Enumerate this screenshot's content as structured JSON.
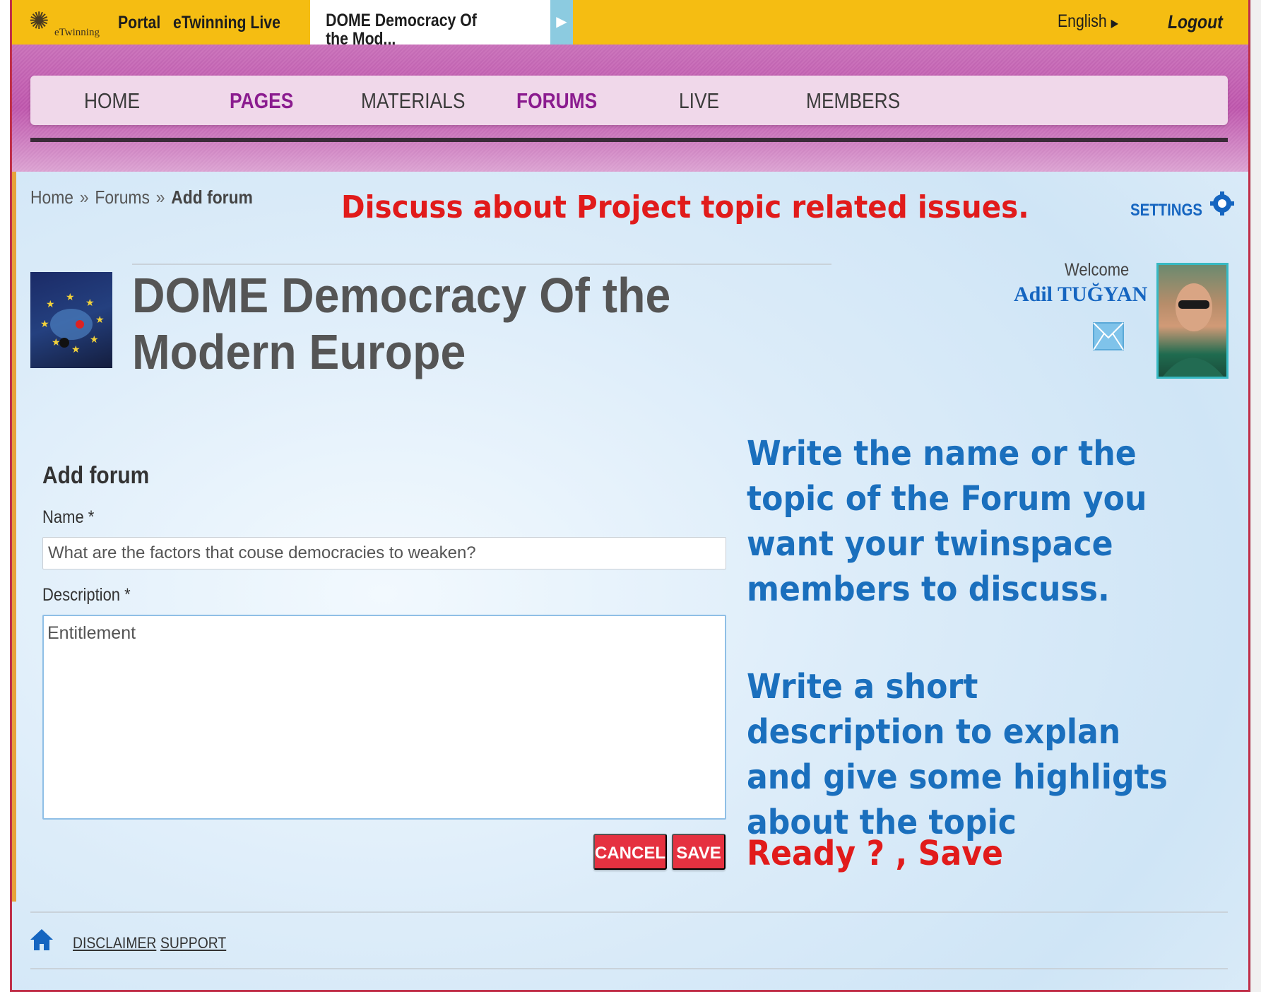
{
  "topbar": {
    "logo_text": "eTwinning",
    "links": [
      "Portal",
      "eTwinning Live"
    ],
    "current_tab": "DOME Democracy Of the Mod...",
    "language": "English",
    "logout": "Logout"
  },
  "nav": {
    "items": [
      {
        "label": "HOME",
        "active": false
      },
      {
        "label": "PAGES",
        "active": true
      },
      {
        "label": "MATERIALS",
        "active": false
      },
      {
        "label": "FORUMS",
        "active": true
      },
      {
        "label": "LIVE",
        "active": false
      },
      {
        "label": "MEMBERS",
        "active": false
      }
    ]
  },
  "breadcrumb": {
    "items": [
      "Home",
      "Forums",
      "Add forum"
    ],
    "separator": "»"
  },
  "annotations": {
    "top": "Discuss about Project topic related issues.",
    "name_help": "Write the name or the topic of the Forum you want your twinspace members to discuss.",
    "desc_help": "Write a short description to explan and give some highligts about the topic",
    "save_help": "Ready ? , Save"
  },
  "settings_label": "SETTINGS",
  "project": {
    "title": "DOME Democracy Of the Modern Europe"
  },
  "user": {
    "welcome": "Welcome",
    "name": "Adil TUĞYAN"
  },
  "form": {
    "heading": "Add forum",
    "name_label": "Name *",
    "name_value": "What are the factors that couse democracies to weaken?",
    "description_label": "Description *",
    "description_value": "Entitlement",
    "cancel": "CANCEL",
    "save": "SAVE"
  },
  "footer": {
    "links": [
      "DISCLAIMER",
      "SUPPORT"
    ]
  },
  "colors": {
    "topbar": "#f5bd12",
    "nav_active": "#8b1c8f",
    "annotation_red": "#e11b1b",
    "annotation_blue": "#1a6fbd",
    "button_red": "#e53140"
  }
}
